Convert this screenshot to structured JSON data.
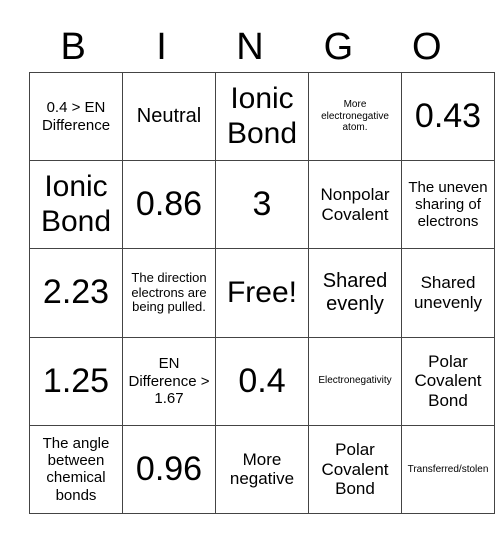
{
  "header": [
    "B",
    "I",
    "N",
    "G",
    "O"
  ],
  "rows": [
    [
      "0.4 > EN Difference",
      "Neutral",
      "Ionic Bond",
      "More electronegative atom.",
      "0.43"
    ],
    [
      "Ionic Bond",
      "0.86",
      "3",
      "Nonpolar Covalent",
      "The uneven sharing of electrons"
    ],
    [
      "2.23",
      "The direction electrons are being pulled.",
      "Free!",
      "Shared evenly",
      "Shared unevenly"
    ],
    [
      "1.25",
      "EN Difference > 1.67",
      "0.4",
      "Electronegativity",
      "Polar Covalent Bond"
    ],
    [
      "The angle between chemical bonds",
      "0.96",
      "More negative",
      "Polar Covalent Bond",
      "Transferred/stolen"
    ]
  ]
}
